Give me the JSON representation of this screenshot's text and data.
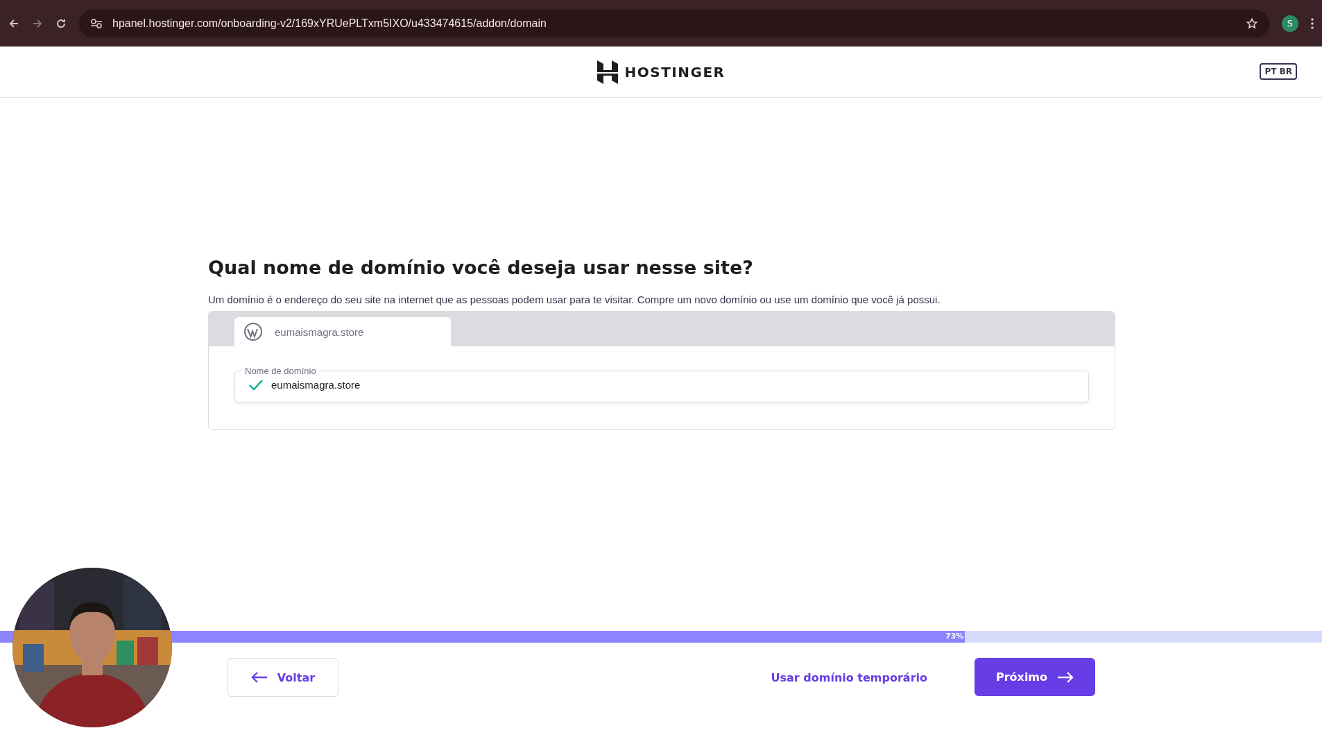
{
  "browser": {
    "url": "hpanel.hostinger.com/onboarding-v2/169xYRUePLTxm5IXO/u433474615/addon/domain",
    "profile": "S"
  },
  "header": {
    "brand": "HOSTINGER",
    "language": "PT BR"
  },
  "question": {
    "title": "Qual nome de domínio você deseja usar nesse site?",
    "description": "Um domínio é o endereço do seu site na internet que as pessoas podem usar para te visitar. Compre um novo domínio ou use um domínio que você já possui."
  },
  "site_tab": {
    "label": "eumaismagra.store"
  },
  "domain_field": {
    "label": "Nome de domínio",
    "value": "eumaismagra.store",
    "valid": true
  },
  "progress": {
    "level": 0.73,
    "reading": "73%"
  },
  "footer": {
    "back": "Voltar",
    "temporary": "Usar domínio temporário",
    "next": "Próximo"
  }
}
